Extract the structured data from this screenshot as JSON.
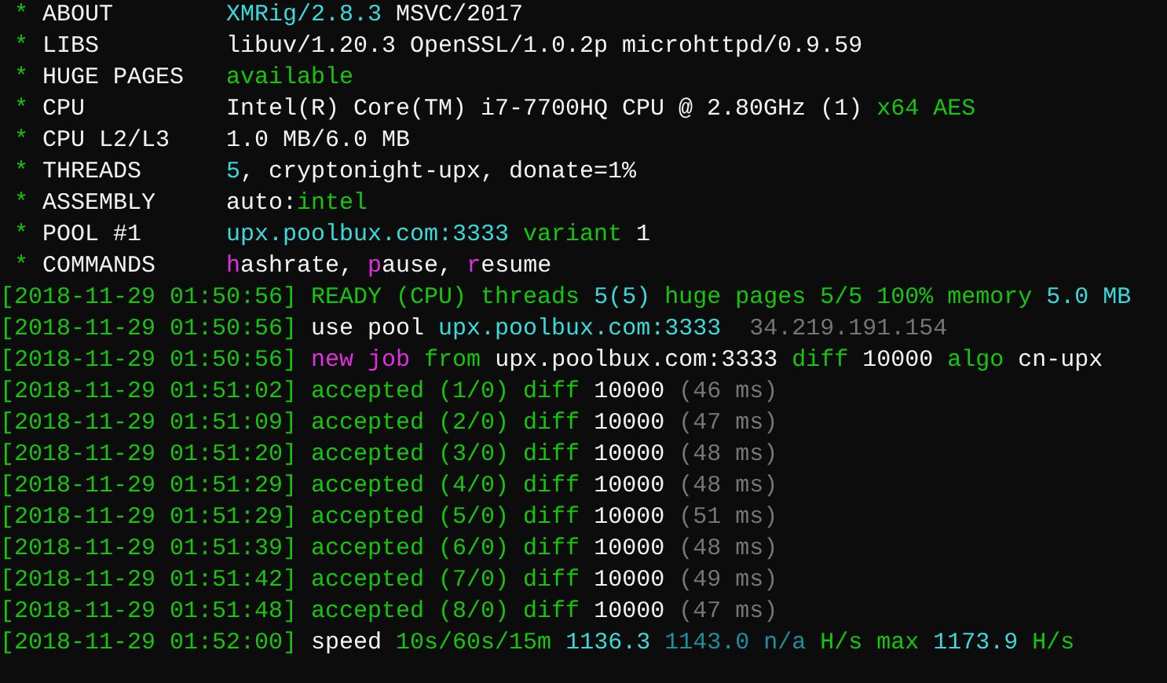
{
  "header": [
    {
      "bullet": "*",
      "label": "ABOUT",
      "value": [
        {
          "text": "XMRig/2.8.3",
          "color": "#3adada"
        },
        {
          "text": " MSVC/2017",
          "color": "#f2f2f2"
        }
      ]
    },
    {
      "bullet": "*",
      "label": "LIBS",
      "value": [
        {
          "text": "libuv/1.20.3 OpenSSL/1.0.2p microhttpd/0.9.59",
          "color": "#f2f2f2"
        }
      ]
    },
    {
      "bullet": "*",
      "label": "HUGE PAGES",
      "value": [
        {
          "text": "available",
          "color": "#16c60c"
        }
      ]
    },
    {
      "bullet": "*",
      "label": "CPU",
      "value": [
        {
          "text": "Intel(R) Core(TM) i7-7700HQ CPU @ 2.80GHz (1) ",
          "color": "#f2f2f2"
        },
        {
          "text": "x64 AES",
          "color": "#16c60c"
        }
      ]
    },
    {
      "bullet": "*",
      "label": "CPU L2/L3",
      "value": [
        {
          "text": "1.0 MB/6.0 MB",
          "color": "#f2f2f2"
        }
      ]
    },
    {
      "bullet": "*",
      "label": "THREADS",
      "value": [
        {
          "text": "5",
          "color": "#3adada"
        },
        {
          "text": ", cryptonight-upx, donate=1%",
          "color": "#f2f2f2"
        }
      ]
    },
    {
      "bullet": "*",
      "label": "ASSEMBLY",
      "value": [
        {
          "text": "auto:",
          "color": "#f2f2f2"
        },
        {
          "text": "intel",
          "color": "#16c60c"
        }
      ]
    },
    {
      "bullet": "*",
      "label": "POOL #1",
      "value": [
        {
          "text": "upx.poolbux.com:3333",
          "color": "#3adada"
        },
        {
          "text": " variant",
          "color": "#16c60c"
        },
        {
          "text": " 1",
          "color": "#f2f2f2"
        }
      ]
    },
    {
      "bullet": "*",
      "label": "COMMANDS",
      "value": [
        {
          "text": "h",
          "color": "#e030e0"
        },
        {
          "text": "ashrate, ",
          "color": "#f2f2f2"
        },
        {
          "text": "p",
          "color": "#e030e0"
        },
        {
          "text": "ause, ",
          "color": "#f2f2f2"
        },
        {
          "text": "r",
          "color": "#e030e0"
        },
        {
          "text": "esume",
          "color": "#f2f2f2"
        }
      ]
    }
  ],
  "log": [
    {
      "timestamp": "[2018-11-29 01:50:56]",
      "message": [
        {
          "text": "READY (CPU) threads ",
          "color": "#16c60c"
        },
        {
          "text": "5(5)",
          "color": "#3adada"
        },
        {
          "text": " huge pages 5/5 100% memory ",
          "color": "#16c60c"
        },
        {
          "text": "5.0 MB",
          "color": "#3adada"
        }
      ]
    },
    {
      "timestamp": "[2018-11-29 01:50:56]",
      "message": [
        {
          "text": "use pool ",
          "color": "#f2f2f2"
        },
        {
          "text": "upx.poolbux.com:3333",
          "color": "#3adada"
        },
        {
          "text": "  34.219.191.154",
          "color": "#767676"
        }
      ]
    },
    {
      "timestamp": "[2018-11-29 01:50:56]",
      "message": [
        {
          "text": "new job",
          "color": "#e030e0"
        },
        {
          "text": " from ",
          "color": "#16c60c"
        },
        {
          "text": "upx.poolbux.com:3333",
          "color": "#f2f2f2"
        },
        {
          "text": " diff ",
          "color": "#16c60c"
        },
        {
          "text": "10000",
          "color": "#f2f2f2"
        },
        {
          "text": " algo ",
          "color": "#16c60c"
        },
        {
          "text": "cn-upx",
          "color": "#f2f2f2"
        }
      ]
    },
    {
      "timestamp": "[2018-11-29 01:51:02]",
      "message": [
        {
          "text": "accepted (1/0) diff ",
          "color": "#16c60c"
        },
        {
          "text": "10000",
          "color": "#f2f2f2"
        },
        {
          "text": " (46 ms)",
          "color": "#767676"
        }
      ]
    },
    {
      "timestamp": "[2018-11-29 01:51:09]",
      "message": [
        {
          "text": "accepted (2/0) diff ",
          "color": "#16c60c"
        },
        {
          "text": "10000",
          "color": "#f2f2f2"
        },
        {
          "text": " (47 ms)",
          "color": "#767676"
        }
      ]
    },
    {
      "timestamp": "[2018-11-29 01:51:20]",
      "message": [
        {
          "text": "accepted (3/0) diff ",
          "color": "#16c60c"
        },
        {
          "text": "10000",
          "color": "#f2f2f2"
        },
        {
          "text": " (48 ms)",
          "color": "#767676"
        }
      ]
    },
    {
      "timestamp": "[2018-11-29 01:51:29]",
      "message": [
        {
          "text": "accepted (4/0) diff ",
          "color": "#16c60c"
        },
        {
          "text": "10000",
          "color": "#f2f2f2"
        },
        {
          "text": " (48 ms)",
          "color": "#767676"
        }
      ]
    },
    {
      "timestamp": "[2018-11-29 01:51:29]",
      "message": [
        {
          "text": "accepted (5/0) diff ",
          "color": "#16c60c"
        },
        {
          "text": "10000",
          "color": "#f2f2f2"
        },
        {
          "text": " (51 ms)",
          "color": "#767676"
        }
      ]
    },
    {
      "timestamp": "[2018-11-29 01:51:39]",
      "message": [
        {
          "text": "accepted (6/0) diff ",
          "color": "#16c60c"
        },
        {
          "text": "10000",
          "color": "#f2f2f2"
        },
        {
          "text": " (48 ms)",
          "color": "#767676"
        }
      ]
    },
    {
      "timestamp": "[2018-11-29 01:51:42]",
      "message": [
        {
          "text": "accepted (7/0) diff ",
          "color": "#16c60c"
        },
        {
          "text": "10000",
          "color": "#f2f2f2"
        },
        {
          "text": " (49 ms)",
          "color": "#767676"
        }
      ]
    },
    {
      "timestamp": "[2018-11-29 01:51:48]",
      "message": [
        {
          "text": "accepted (8/0) diff ",
          "color": "#16c60c"
        },
        {
          "text": "10000",
          "color": "#f2f2f2"
        },
        {
          "text": " (47 ms)",
          "color": "#767676"
        }
      ]
    },
    {
      "timestamp": "[2018-11-29 01:52:00]",
      "message": [
        {
          "text": "speed ",
          "color": "#f2f2f2"
        },
        {
          "text": "10s/60s/15m ",
          "color": "#16c60c"
        },
        {
          "text": "1136.3",
          "color": "#3adada"
        },
        {
          "text": " 1143.0 n/a",
          "color": "#1d8f9e"
        },
        {
          "text": " H/s max ",
          "color": "#16c60c"
        },
        {
          "text": "1173.9",
          "color": "#3adada"
        },
        {
          "text": " H/s",
          "color": "#16c60c"
        }
      ]
    }
  ]
}
